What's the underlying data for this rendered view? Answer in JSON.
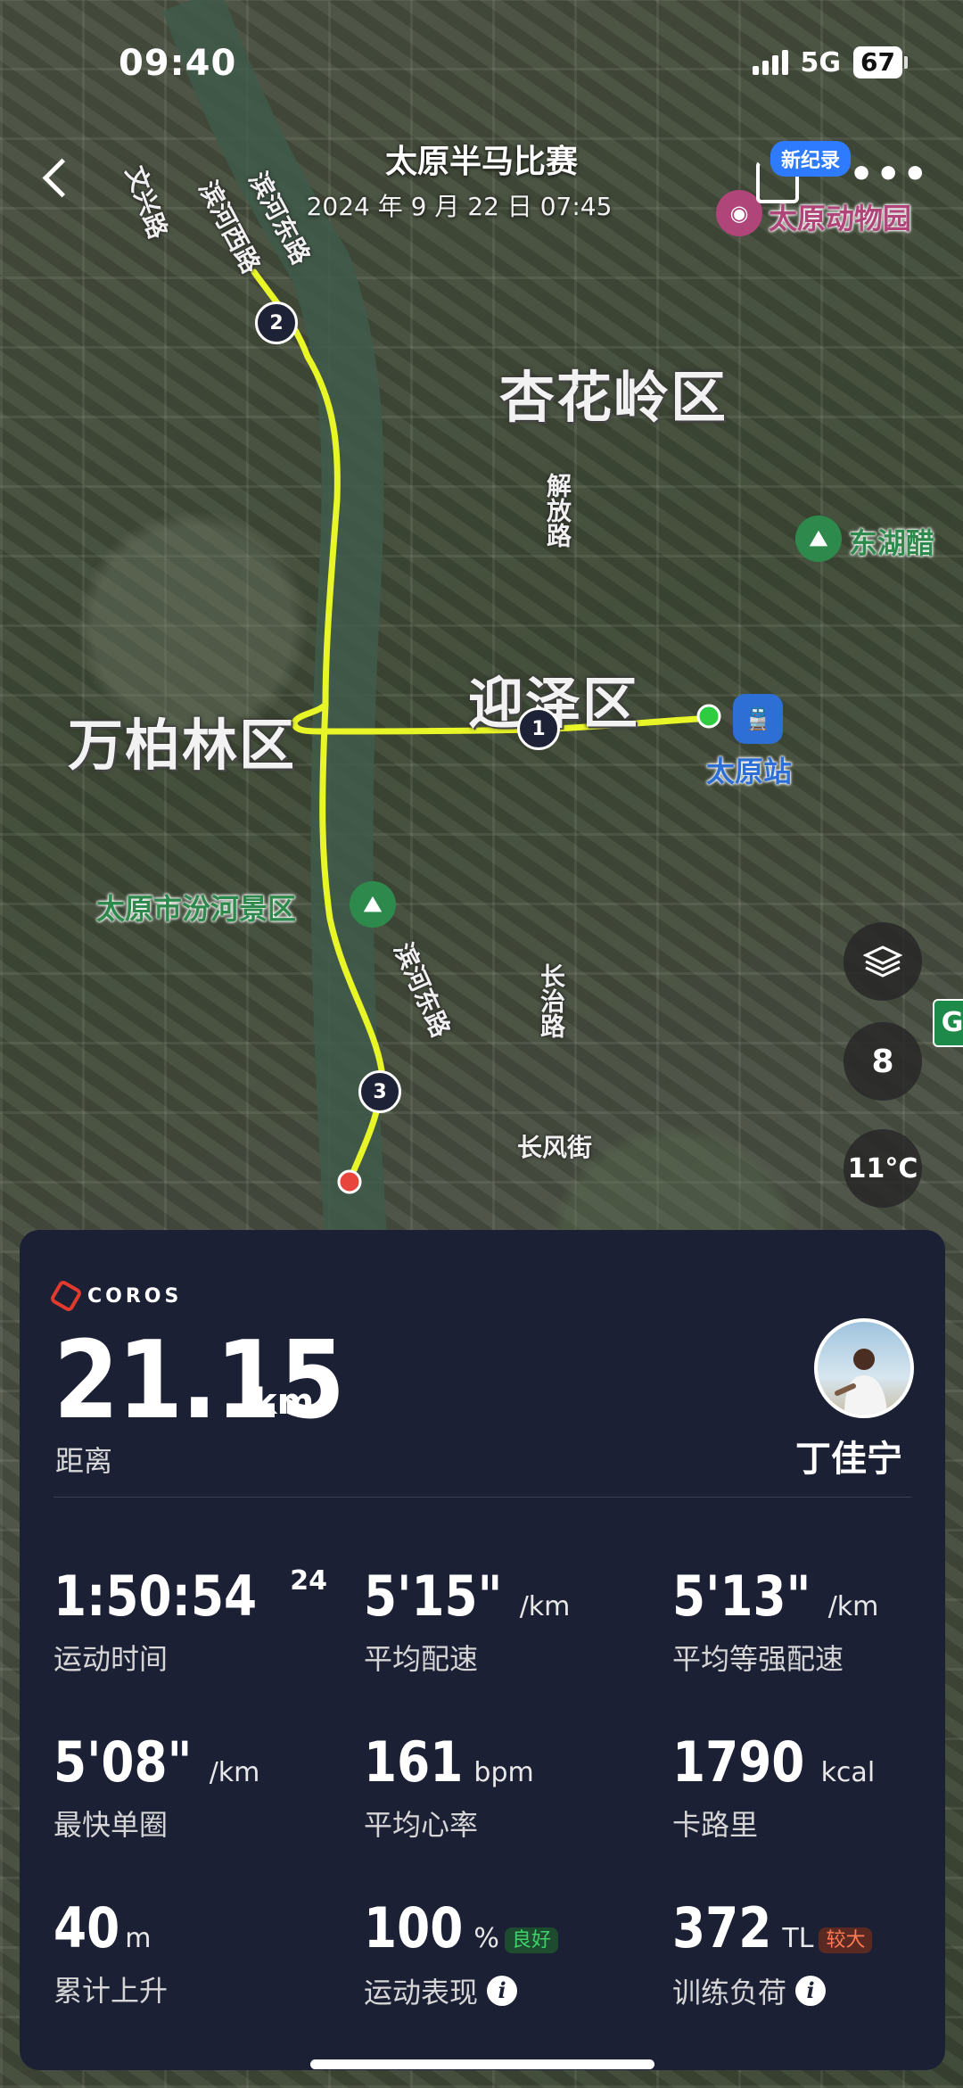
{
  "status_bar": {
    "time": "09:40",
    "network": "5G",
    "battery": "67"
  },
  "header": {
    "title": "太原半马比赛",
    "subtitle": "2024 年 9 月 22 日 07:45",
    "new_record_badge": "新纪录"
  },
  "map": {
    "districts": [
      "杏花岭区",
      "迎泽区",
      "万柏林区"
    ],
    "roads": [
      "文兴路",
      "滨河西路",
      "滨河东路",
      "解放路",
      "滨河东路",
      "长治路",
      "长风街"
    ],
    "pois": [
      "太原动物园",
      "东湖醋",
      "太原站",
      "太原市汾河景区"
    ],
    "lap_markers": [
      "1",
      "2",
      "3"
    ],
    "route_color": "#e8f526",
    "start_color": "#2ecc40",
    "end_color": "#e8463c",
    "compass_value": "8",
    "weather": "11°C",
    "edge_sign": "G"
  },
  "card": {
    "brand": "COROS",
    "distance": {
      "value": "21.15",
      "unit": "km",
      "label": "距离"
    },
    "user_name": "丁佳宁",
    "stats": [
      {
        "value": "1:50:54",
        "sup": "24",
        "unit": "",
        "label": "运动时间"
      },
      {
        "value": "5'15\"",
        "unit": "/km",
        "label": "平均配速"
      },
      {
        "value": "5'13\"",
        "unit": "/km",
        "label": "平均等强配速"
      },
      {
        "value": "5'08\"",
        "unit": "/km",
        "label": "最快单圈"
      },
      {
        "value": "161",
        "unit": "bpm",
        "label": "平均心率"
      },
      {
        "value": "1790",
        "unit": "kcal",
        "label": "卡路里"
      },
      {
        "value": "40",
        "unit": "m",
        "label": "累计上升"
      },
      {
        "value": "100",
        "unit": "%",
        "tag": "良好",
        "tag_color": "#2fbf55",
        "label": "运动表现"
      },
      {
        "value": "372",
        "unit": "TL",
        "tag": "较大",
        "tag_color": "#e8643c",
        "label": "训练负荷"
      }
    ]
  }
}
